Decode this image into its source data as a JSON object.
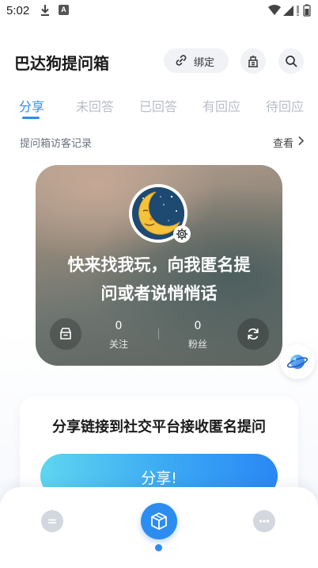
{
  "status_bar": {
    "time": "5:02",
    "a_badge": "A"
  },
  "header": {
    "title": "巴达狗提问箱",
    "bind_label": "绑定"
  },
  "tabs": [
    {
      "label": "分享",
      "active": true
    },
    {
      "label": "未回答",
      "active": false
    },
    {
      "label": "已回答",
      "active": false
    },
    {
      "label": "有回应",
      "active": false
    },
    {
      "label": "待回应",
      "active": false
    }
  ],
  "visitors": {
    "label": "提问箱访客记录",
    "view_label": "查看"
  },
  "profile": {
    "motto_line1": "快来找我玩，向我匿名提",
    "motto_line2": "问或者说悄悄话",
    "following_count": "0",
    "following_label": "关注",
    "followers_count": "0",
    "followers_label": "粉丝"
  },
  "share": {
    "heading": "分享链接到社交平台接收匿名提问",
    "button_label": "分享!"
  },
  "colors": {
    "accent": "#2d8cf0",
    "tab_inactive": "#b8bdc6",
    "nav_inactive": "#d3d7de"
  },
  "icons": {
    "bind": "link-icon",
    "home": "building-icon",
    "search": "search-icon",
    "card_left": "inbox-icon",
    "card_right": "refresh-icon",
    "avatar_badge": "gear-icon",
    "floating": "planet-icon",
    "nav_left": "chat-icon",
    "nav_center": "box-icon",
    "nav_right": "more-icon"
  }
}
